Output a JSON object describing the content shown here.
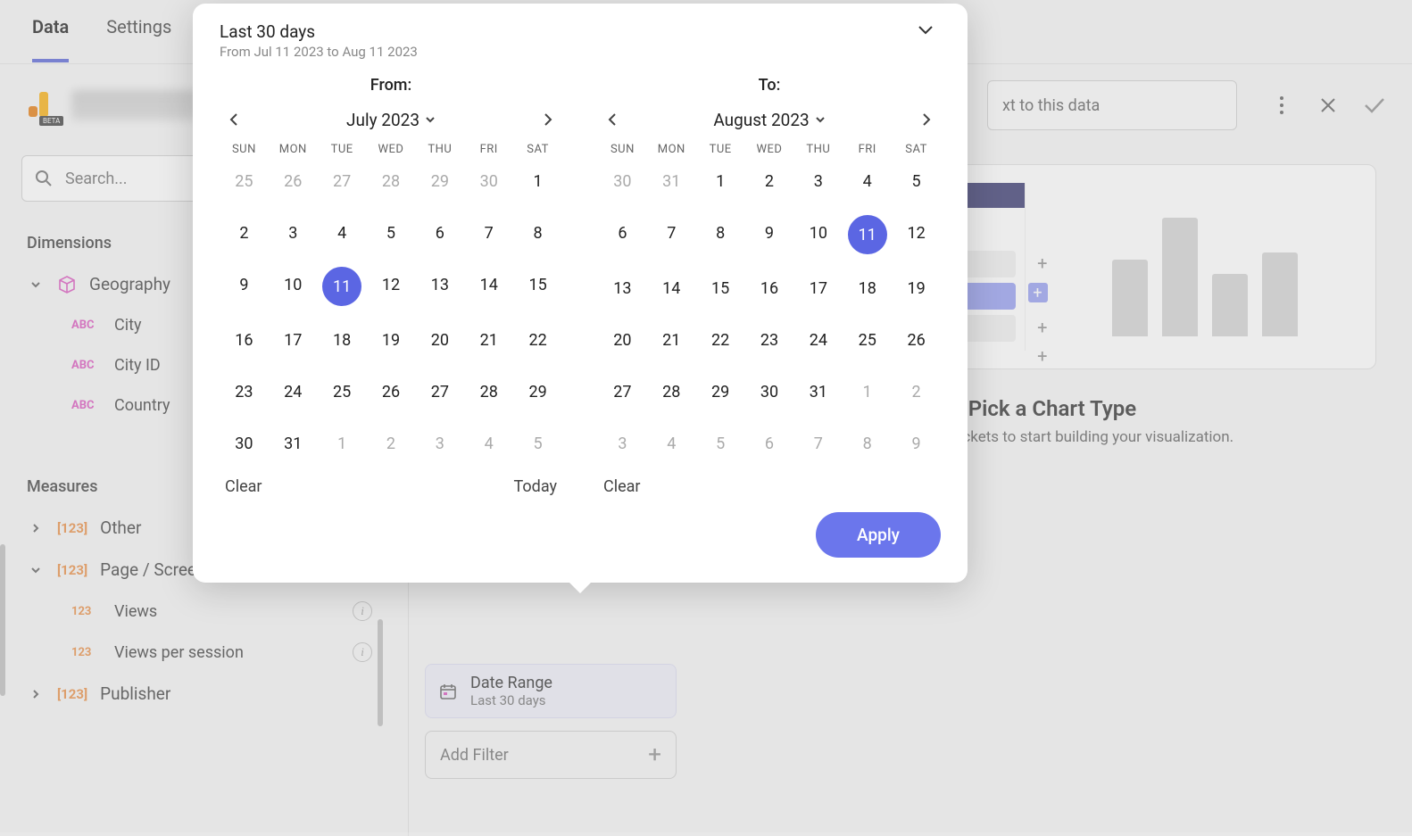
{
  "tabs": {
    "data": "Data",
    "settings": "Settings"
  },
  "brand": {
    "beta": "BETA"
  },
  "header": {
    "context_placeholder": "xt to this data"
  },
  "search": {
    "placeholder": "Search..."
  },
  "sections": {
    "dimensions": "Dimensions",
    "measures": "Measures"
  },
  "dimensions": {
    "group": "Geography",
    "items": [
      "City",
      "City ID",
      "Country"
    ]
  },
  "measures": {
    "other": "Other",
    "page_screen": "Page / Screen",
    "views": "Views",
    "views_per_session": "Views per session",
    "publisher": "Publisher"
  },
  "date_chip": {
    "title": "Date Range",
    "subtitle": "Last 30 days"
  },
  "add_filter": "Add Filter",
  "chart_panel": {
    "title": "Pick a Chart Type",
    "subtitle": "ds into the buckets to start building your visualization."
  },
  "popover": {
    "title": "Last 30 days",
    "subtitle": "From Jul 11 2023 to Aug 11 2023",
    "from_label": "From:",
    "to_label": "To:",
    "from_month": "July 2023",
    "to_month": "August 2023",
    "dow": [
      "SUN",
      "MON",
      "TUE",
      "WED",
      "THU",
      "FRI",
      "SAT"
    ],
    "from_grid": [
      {
        "n": "25",
        "off": true
      },
      {
        "n": "26",
        "off": true
      },
      {
        "n": "27",
        "off": true
      },
      {
        "n": "28",
        "off": true
      },
      {
        "n": "29",
        "off": true
      },
      {
        "n": "30",
        "off": true
      },
      {
        "n": "1"
      },
      {
        "n": "2"
      },
      {
        "n": "3"
      },
      {
        "n": "4"
      },
      {
        "n": "5"
      },
      {
        "n": "6"
      },
      {
        "n": "7"
      },
      {
        "n": "8"
      },
      {
        "n": "9"
      },
      {
        "n": "10"
      },
      {
        "n": "11",
        "sel": true
      },
      {
        "n": "12"
      },
      {
        "n": "13"
      },
      {
        "n": "14"
      },
      {
        "n": "15"
      },
      {
        "n": "16"
      },
      {
        "n": "17"
      },
      {
        "n": "18"
      },
      {
        "n": "19"
      },
      {
        "n": "20"
      },
      {
        "n": "21"
      },
      {
        "n": "22"
      },
      {
        "n": "23"
      },
      {
        "n": "24"
      },
      {
        "n": "25"
      },
      {
        "n": "26"
      },
      {
        "n": "27"
      },
      {
        "n": "28"
      },
      {
        "n": "29"
      },
      {
        "n": "30"
      },
      {
        "n": "31"
      },
      {
        "n": "1",
        "off": true
      },
      {
        "n": "2",
        "off": true
      },
      {
        "n": "3",
        "off": true
      },
      {
        "n": "4",
        "off": true
      },
      {
        "n": "5",
        "off": true
      }
    ],
    "to_grid": [
      {
        "n": "30",
        "off": true
      },
      {
        "n": "31",
        "off": true
      },
      {
        "n": "1"
      },
      {
        "n": "2"
      },
      {
        "n": "3"
      },
      {
        "n": "4"
      },
      {
        "n": "5"
      },
      {
        "n": "6"
      },
      {
        "n": "7"
      },
      {
        "n": "8"
      },
      {
        "n": "9"
      },
      {
        "n": "10"
      },
      {
        "n": "11",
        "sel": true
      },
      {
        "n": "12"
      },
      {
        "n": "13"
      },
      {
        "n": "14"
      },
      {
        "n": "15"
      },
      {
        "n": "16"
      },
      {
        "n": "17"
      },
      {
        "n": "18"
      },
      {
        "n": "19"
      },
      {
        "n": "20"
      },
      {
        "n": "21"
      },
      {
        "n": "22"
      },
      {
        "n": "23"
      },
      {
        "n": "24"
      },
      {
        "n": "25"
      },
      {
        "n": "26"
      },
      {
        "n": "27"
      },
      {
        "n": "28"
      },
      {
        "n": "29"
      },
      {
        "n": "30"
      },
      {
        "n": "31"
      },
      {
        "n": "1",
        "off": true
      },
      {
        "n": "2",
        "off": true
      },
      {
        "n": "3",
        "off": true
      },
      {
        "n": "4",
        "off": true
      },
      {
        "n": "5",
        "off": true
      },
      {
        "n": "6",
        "off": true
      },
      {
        "n": "7",
        "off": true
      },
      {
        "n": "8",
        "off": true
      },
      {
        "n": "9",
        "off": true
      }
    ],
    "clear": "Clear",
    "today": "Today",
    "apply": "Apply"
  },
  "badges": {
    "abc": "ABC",
    "num": "123"
  },
  "icons": {
    "plus": "+"
  }
}
